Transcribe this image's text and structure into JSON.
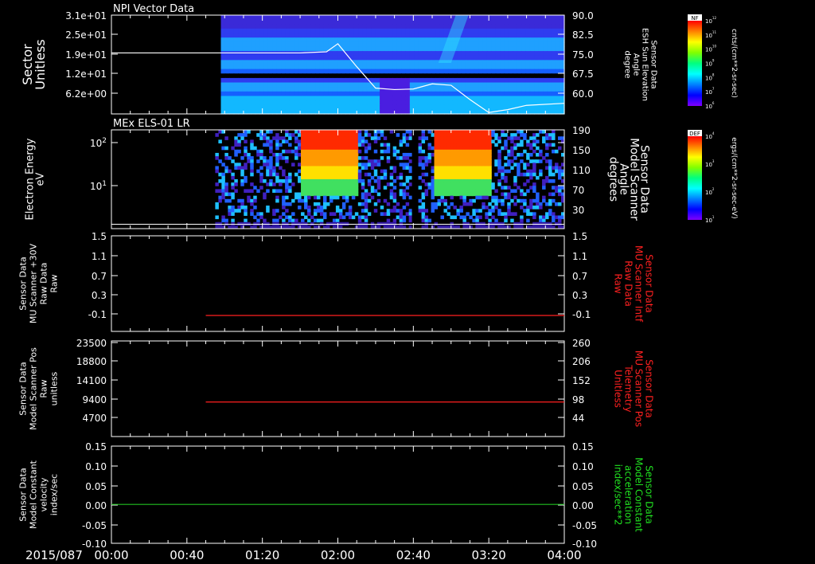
{
  "colors": {
    "background": "#000000",
    "axis": "#ffffff",
    "red_trace": "#ff2020",
    "green_trace": "#20c020",
    "red_label": "#ff2020",
    "green_label": "#20e020"
  },
  "x_axis": {
    "date_label": "2015/087",
    "ticks": [
      "00:00",
      "00:40",
      "01:20",
      "02:00",
      "02:40",
      "03:20",
      "04:00"
    ]
  },
  "panels": [
    {
      "title": "NPI Vector Data",
      "left_label": [
        "Sector",
        "Unitless"
      ],
      "right_label": [
        "Sensor Data",
        "ESH Sun Elevation",
        "Angle",
        "degree"
      ],
      "left_ticks": [
        "3.1e+01",
        "2.5e+01",
        "1.9e+01",
        "1.2e+01",
        "6.2e+00"
      ],
      "right_ticks": [
        "90.0",
        "82.5",
        "75.0",
        "67.5",
        "60.0"
      ],
      "colorbar_title": "NF",
      "colorbar_unit": "cnts/(cm**2-sr-sec)",
      "colorbar_ticks": [
        "10^12",
        "10^11",
        "10^10",
        "10^9",
        "10^8",
        "10^7",
        "10^6"
      ]
    },
    {
      "title": "MEx ELS-01 LR",
      "left_label": [
        "Electron Energy",
        "eV"
      ],
      "right_label": [
        "Sensor Data",
        "Model Scanner",
        "Angle",
        "degrees"
      ],
      "left_ticks": [
        "10^2",
        "10^1"
      ],
      "right_ticks": [
        "190",
        "150",
        "110",
        "70",
        "30"
      ],
      "colorbar_title": "DEF",
      "colorbar_unit": "ergs/(cm**2-sr-sec-eV)",
      "colorbar_ticks": [
        "10^4",
        "10^3",
        "10^2",
        "10^1"
      ]
    },
    {
      "title": "",
      "left_label": [
        "Sensor Data",
        "MU Scanner +30V",
        "Raw Data",
        "Raw"
      ],
      "right_label": [
        "Sensor Data",
        "MU Scanner Intf",
        "Raw Data",
        "Raw"
      ],
      "left_ticks": [
        "1.5",
        "1.1",
        "0.7",
        "0.3",
        "-0.1"
      ],
      "right_ticks": [
        "1.5",
        "1.1",
        "0.7",
        "0.3",
        "-0.1"
      ]
    },
    {
      "title": "",
      "left_label": [
        "Sensor Data",
        "Model Scanner Pos",
        "Raw",
        "unitless"
      ],
      "right_label": [
        "Sensor Data",
        "MU Scanner Pos",
        "Telemetry",
        "Unitless"
      ],
      "left_ticks": [
        "23500",
        "18800",
        "14100",
        "9400",
        "4700"
      ],
      "right_ticks": [
        "260",
        "206",
        "152",
        "98",
        "44"
      ]
    },
    {
      "title": "",
      "left_label": [
        "Sensor Data",
        "Model Constant",
        "velocity",
        "index/sec"
      ],
      "right_label": [
        "Sensor Data",
        "Model Constant",
        "acceleration",
        "index/sec**2"
      ],
      "left_ticks": [
        "0.15",
        "0.10",
        "0.05",
        "0.00",
        "-0.05",
        "-0.10"
      ],
      "right_ticks": [
        "0.15",
        "0.10",
        "0.05",
        "0.00",
        "-0.05",
        "-0.10"
      ]
    }
  ],
  "chart_data": [
    {
      "type": "heatmap",
      "title": "NPI Vector Data",
      "xlabel": "",
      "ylabel": "Sector Unitless",
      "x_range": [
        "00:00",
        "04:00"
      ],
      "data_start": "00:58",
      "y2label": "Sensor Data ESH Sun Elevation Angle degree",
      "y2lim": [
        55.5,
        90.0
      ],
      "line_series": {
        "name": "ESH Sun Elevation Angle",
        "x": [
          "00:00",
          "00:58",
          "01:40",
          "01:54",
          "02:00",
          "02:10",
          "02:20",
          "02:30",
          "02:40",
          "02:50",
          "03:00",
          "03:10",
          "03:20",
          "03:30",
          "03:40",
          "04:00"
        ],
        "y": [
          76.8,
          76.8,
          76.8,
          77.2,
          80.0,
          72.0,
          64.5,
          64.0,
          64.2,
          66.0,
          65.5,
          60.5,
          56.0,
          57.0,
          58.5,
          59.2
        ]
      }
    },
    {
      "type": "heatmap",
      "title": "MEx ELS-01 LR",
      "xlabel": "",
      "ylabel": "Electron Energy eV",
      "y_scale": "log",
      "x_range": [
        "00:00",
        "04:00"
      ],
      "data_start": "00:55",
      "hot_intervals": [
        [
          "01:40",
          "02:10"
        ],
        [
          "02:50",
          "03:20"
        ]
      ],
      "y2label": "Sensor Data Model Scanner Angle degrees",
      "y2lim": [
        10,
        190
      ],
      "line_series": {
        "name": "Model Scanner Angle",
        "x": [
          "00:00",
          "04:00"
        ],
        "y": [
          18,
          18
        ]
      }
    },
    {
      "type": "line",
      "title": "",
      "ylabel": "Sensor Data MU Scanner +30V Raw Data Raw",
      "ylim": [
        -0.3,
        1.5
      ],
      "y2label": "Sensor Data MU Scanner Intf Raw Data Raw",
      "series": [
        {
          "x": [
            "00:50",
            "04:00"
          ],
          "values": [
            0.0,
            0.0
          ]
        }
      ]
    },
    {
      "type": "line",
      "title": "",
      "ylabel": "Sensor Data Model Scanner Pos Raw unitless",
      "ylim": [
        0,
        23500
      ],
      "y2label": "Sensor Data MU Scanner Pos Telemetry Unitless",
      "series": [
        {
          "x": [
            "00:50",
            "04:00"
          ],
          "values": [
            8500,
            8500
          ]
        }
      ]
    },
    {
      "type": "line",
      "title": "",
      "ylabel": "Sensor Data Model Constant velocity index/sec",
      "ylim": [
        -0.1,
        0.15
      ],
      "y2label": "Sensor Data Model Constant acceleration index/sec**2",
      "series": [
        {
          "x": [
            "00:00",
            "04:00"
          ],
          "values": [
            0.0,
            0.0
          ]
        }
      ]
    }
  ]
}
